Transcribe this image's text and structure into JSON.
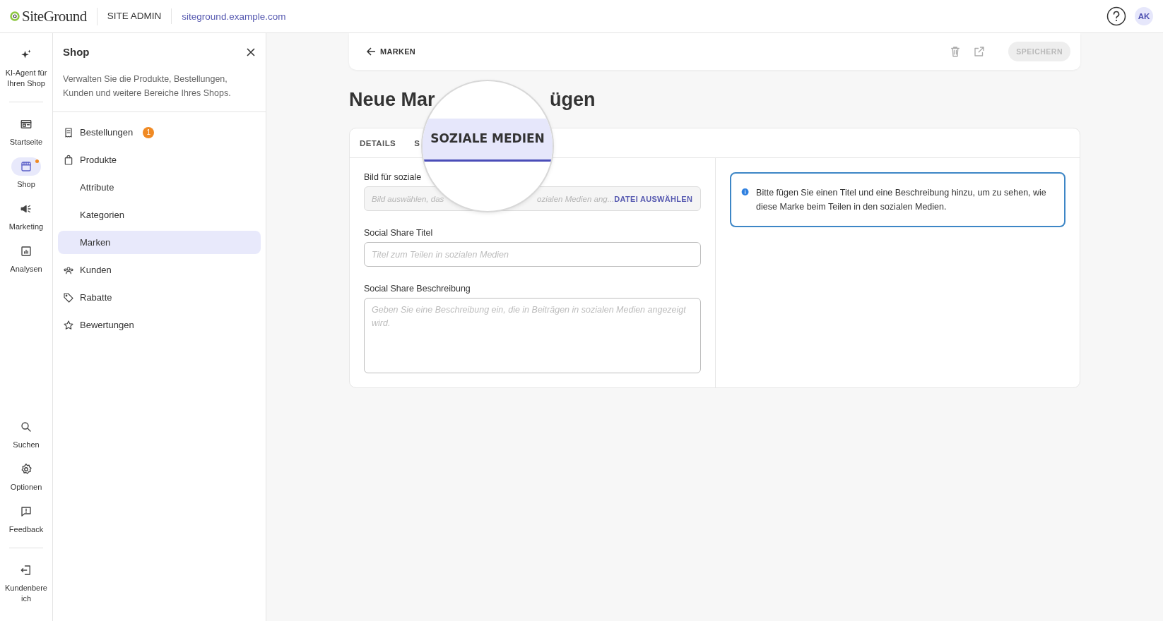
{
  "header": {
    "logo": "SiteGround",
    "section": "SITE ADMIN",
    "site": "siteground.example.com",
    "avatar": "AK"
  },
  "rail": {
    "top": [
      {
        "kind": "ai",
        "label": "KI-Agent für Ihren Shop",
        "selected": false,
        "dot": false
      },
      {
        "kind": "home",
        "label": "Startseite",
        "selected": false,
        "dot": false
      },
      {
        "kind": "shop",
        "label": "Shop",
        "selected": true,
        "dot": true
      },
      {
        "kind": "marketing",
        "label": "Marketing",
        "selected": false,
        "dot": false
      },
      {
        "kind": "analytics",
        "label": "Analysen",
        "selected": false,
        "dot": false
      }
    ],
    "bottom": [
      {
        "kind": "search",
        "label": "Suchen",
        "selected": false,
        "dot": false
      },
      {
        "kind": "settings",
        "label": "Optionen",
        "selected": false,
        "dot": false
      },
      {
        "kind": "feedback",
        "label": "Feedback",
        "selected": false,
        "dot": false
      },
      {
        "kind": "exit",
        "label": "Kundenbereich",
        "selected": false,
        "dot": false
      }
    ]
  },
  "panel": {
    "title": "Shop",
    "description": "Verwalten Sie die Produkte, Bestellungen, Kunden und weitere Bereiche Ihres Shops.",
    "items": [
      {
        "kind": "orders",
        "label": "Bestellungen",
        "badge": "1",
        "selected": false
      },
      {
        "kind": "products",
        "label": "Produkte",
        "selected": false
      },
      {
        "kind": "sub",
        "label": "Attribute",
        "selected": false
      },
      {
        "kind": "sub",
        "label": "Kategorien",
        "selected": false
      },
      {
        "kind": "sub",
        "label": "Marken",
        "selected": true
      },
      {
        "kind": "customers",
        "label": "Kunden",
        "selected": false
      },
      {
        "kind": "discounts",
        "label": "Rabatte",
        "selected": false
      },
      {
        "kind": "reviews",
        "label": "Bewertungen",
        "selected": false
      }
    ]
  },
  "toolbar": {
    "back": "MARKEN",
    "save": {
      "label": "SPEICHERN",
      "disabled": true
    }
  },
  "heading_parts": [
    "Neue Mar",
    "ügen"
  ],
  "tabs": [
    {
      "label": "DETAILS"
    },
    {
      "label": "S"
    }
  ],
  "magnifier": {
    "label": "SOZIALE MEDIEN",
    "selected": true
  },
  "form": {
    "image": {
      "label": "Bild für soziale",
      "hint_parts": [
        "Bild auswählen, das",
        "ozialen Medien ang..."
      ],
      "button": "DATEI AUSWÄHLEN"
    },
    "title": {
      "label": "Social Share Titel",
      "placeholder": "Titel zum Teilen in sozialen Medien"
    },
    "description": {
      "label": "Social Share Beschreibung",
      "placeholder": "Geben Sie eine Beschreibung ein, die in Beiträgen in sozialen Medien angezeigt wird."
    }
  },
  "info": "Bitte fügen Sie einen Titel und eine Beschreibung hinzu, um zu sehen, wie diese Marke beim Teilen in den sozialen Medien."
}
